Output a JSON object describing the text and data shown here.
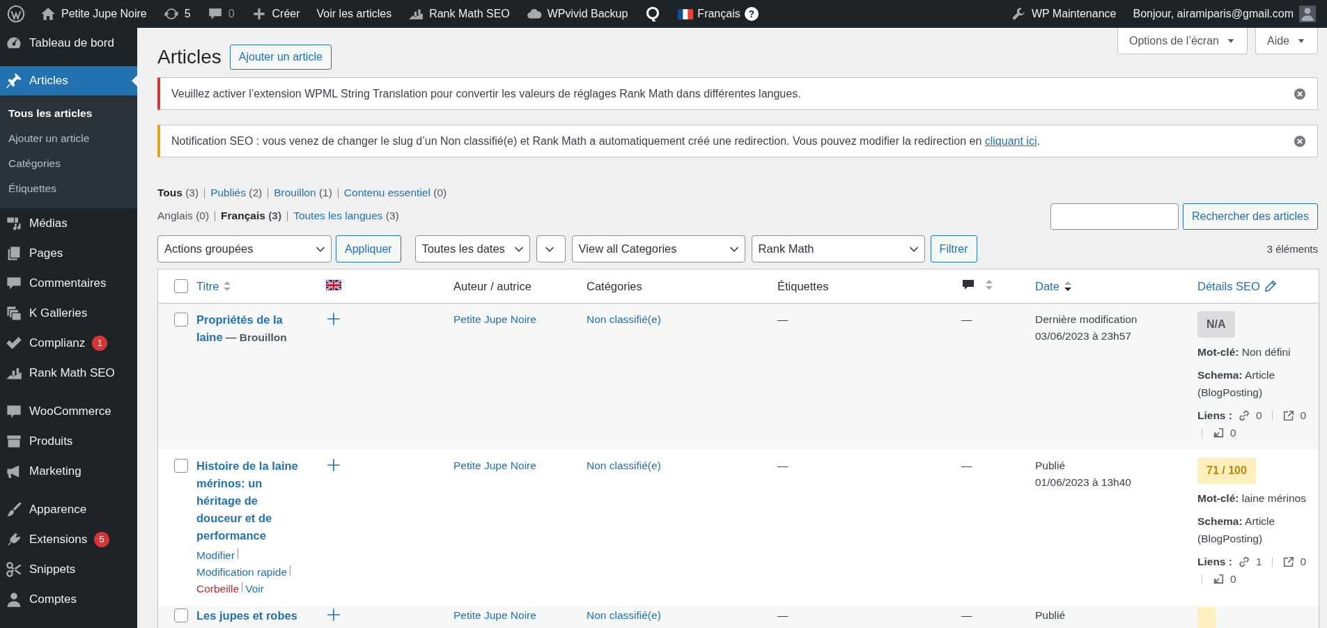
{
  "admin_bar": {
    "left": [
      {
        "kind": "logo"
      },
      {
        "kind": "home",
        "label": "Petite Jupe Noire"
      },
      {
        "kind": "updates",
        "label": "5"
      },
      {
        "kind": "comment",
        "label": "0"
      },
      {
        "kind": "plus",
        "label": "Créer"
      },
      {
        "kind": "text",
        "label": "Voir les articles"
      },
      {
        "kind": "rankmath",
        "label": "Rank Math SEO"
      },
      {
        "kind": "cloud",
        "label": "WPvivid Backup"
      },
      {
        "kind": "q"
      },
      {
        "kind": "language",
        "label": "Français",
        "help": "?"
      }
    ],
    "right": [
      {
        "kind": "wrench",
        "label": "WP Maintenance"
      },
      {
        "kind": "account",
        "label": "Bonjour, airamiparis@gmail.com"
      }
    ]
  },
  "sidebar": {
    "groups": [
      {
        "items": [
          {
            "kind": "dashboard",
            "label": "Tableau de bord",
            "selected": false
          }
        ]
      },
      {
        "items": [
          {
            "kind": "pin",
            "label": "Articles",
            "selected": true,
            "children": [
              {
                "label": "Tous les articles",
                "selected": true
              },
              {
                "label": "Ajouter un article",
                "selected": false
              },
              {
                "label": "Catégories",
                "selected": false
              },
              {
                "label": "Étiquettes",
                "selected": false
              }
            ]
          },
          {
            "kind": "media",
            "label": "Médias",
            "selected": false
          },
          {
            "kind": "pages",
            "label": "Pages",
            "selected": false
          },
          {
            "kind": "comment",
            "label": "Commentaires",
            "selected": false
          },
          {
            "kind": "gallery",
            "label": "K Galleries",
            "selected": false
          },
          {
            "kind": "check",
            "label": "Complianz",
            "selected": false,
            "badge": "1"
          },
          {
            "kind": "rankmath",
            "label": "Rank Math SEO",
            "selected": false
          }
        ]
      },
      {
        "items": [
          {
            "kind": "woo",
            "label": "WooCommerce",
            "selected": false
          },
          {
            "kind": "box",
            "label": "Produits",
            "selected": false
          },
          {
            "kind": "megaphone",
            "label": "Marketing",
            "selected": false
          }
        ]
      },
      {
        "items": [
          {
            "kind": "brush",
            "label": "Apparence",
            "selected": false
          },
          {
            "kind": "plug",
            "label": "Extensions",
            "selected": false,
            "badge": "5"
          },
          {
            "kind": "scissors",
            "label": "Snippets",
            "selected": false
          },
          {
            "kind": "user",
            "label": "Comptes",
            "selected": false
          }
        ]
      }
    ]
  },
  "screen_meta": [
    "Options de l’écran",
    "Aide"
  ],
  "page": {
    "title": "Articles",
    "add_button": "Ajouter un article"
  },
  "notices": [
    {
      "kind": "error",
      "text": "Veuillez activer l’extension WPML String Translation pour convertir les valeurs de réglages Rank Math dans différentes langues."
    },
    {
      "kind": "warning",
      "text": "Notification SEO : vous venez de changer le slug d’un Non classifié(e) et Rank Math a automatiquement créé une redirection. Vous pouvez modifier la redirection en",
      "link": "cliquant ici",
      "after": "."
    }
  ],
  "views": [
    {
      "label": "Tous",
      "count": "(3)",
      "selected": true
    },
    {
      "label": "Publiés",
      "count": "(2)",
      "selected": false
    },
    {
      "label": "Brouillon",
      "count": "(1)",
      "selected": false
    },
    {
      "label": "Contenu essentiel",
      "count": "(0)",
      "selected": false
    }
  ],
  "languages": [
    {
      "label": "Anglais",
      "count": "(0)",
      "selected": false,
      "disabled": true
    },
    {
      "label": "Français",
      "count": "(3)",
      "selected": true,
      "disabled": false
    },
    {
      "label": "Toutes les langues",
      "count": "(3)",
      "selected": false,
      "disabled": false
    }
  ],
  "search": {
    "button": "Rechercher des articles"
  },
  "filters": {
    "bulk_action": "Actions groupées",
    "apply": "Appliquer",
    "selects": [
      {
        "kind": "dropdown",
        "label": "Toutes les dates"
      },
      {
        "kind": "compact"
      },
      {
        "kind": "dropdown",
        "label": "View all Categories"
      },
      {
        "kind": "dropdown",
        "label": "Rank Math"
      }
    ],
    "filter": "Filtrer",
    "count": "3 éléments"
  },
  "table": {
    "select_all": false,
    "columns": [
      {
        "kind": "check"
      },
      {
        "kind": "text",
        "label": "Titre",
        "sorted": false
      },
      {
        "kind": "flag"
      },
      {
        "kind": "plain",
        "label": "Auteur / autrice"
      },
      {
        "kind": "plain",
        "label": "Catégories"
      },
      {
        "kind": "plain",
        "label": "Étiquettes"
      },
      {
        "kind": "comments",
        "sorted": false
      },
      {
        "kind": "text",
        "label": "Date",
        "sorted": true
      },
      {
        "kind": "edit",
        "label": "Détails SEO"
      }
    ],
    "rows": [
      {
        "checked": false,
        "title": "Propriétés de la laine",
        "state": "— Brouillon",
        "author": "Petite Jupe Noire",
        "categories": "Non classifié(e)",
        "tags": "—",
        "comments": "—",
        "date_status": "Dernière modification",
        "date": "03/06/2023 à 23h57",
        "seo": {
          "kind": "none",
          "score": "N/A",
          "keyword": "**Mot-clé:** Non défini",
          "schema": "**Schema:** Article (BlogPosting)",
          "links_label": "Liens :",
          "internal": "0",
          "external": "0",
          "incoming": "0"
        }
      },
      {
        "checked": false,
        "title": "Histoire de la laine mérinos: un héritage de douceur et de performance",
        "actions": [
          {
            "kind": "link",
            "label": "Modifier"
          },
          {
            "kind": "link",
            "label": "Modification rapide"
          },
          {
            "kind": "delete",
            "label": "Corbeille"
          },
          {
            "kind": "link",
            "label": "Voir"
          }
        ],
        "author": "Petite Jupe Noire",
        "categories": "Non classifié(e)",
        "tags": "—",
        "comments": "—",
        "date_status": "Publié",
        "date": "01/06/2023 à 13h40",
        "seo": {
          "kind": "warning",
          "score": "71 / 100",
          "keyword": "**Mot-clé:** laine mérinos",
          "schema": "**Schema:** Article (BlogPosting)",
          "links_label": "Liens :",
          "internal": "1",
          "external": "0",
          "incoming": "0"
        }
      },
      {
        "checked": false,
        "title": "Les jupes et robes",
        "author": "Petite Jupe Noire",
        "categories": "Non classifié(e)",
        "tags": "—",
        "comments": "—",
        "date_status": "Publié",
        "seo": {
          "kind": "warning"
        }
      }
    ]
  }
}
